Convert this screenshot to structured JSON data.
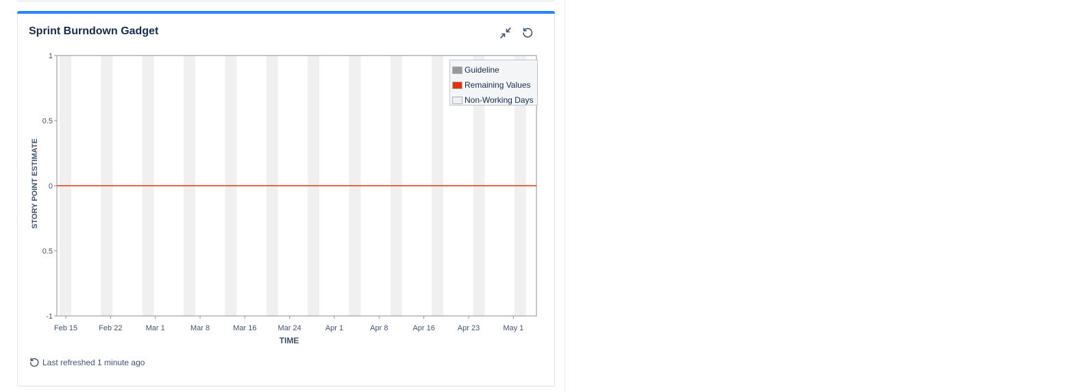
{
  "gadget": {
    "title": "Sprint Burndown Gadget",
    "accent_color": "#2684ff",
    "actions": [
      {
        "icon": "minimize-icon"
      },
      {
        "icon": "refresh-icon"
      }
    ],
    "footer": {
      "icon": "refresh-icon",
      "text": "Last refreshed 1 minute ago"
    }
  },
  "chart_data": {
    "type": "line",
    "xlabel": "TIME",
    "ylabel": "STORY POINT ESTIMATE",
    "x_tick_labels": [
      "Feb 15",
      "Feb 22",
      "Mar 1",
      "Mar 8",
      "Mar 16",
      "Mar 24",
      "Apr 1",
      "Apr 8",
      "Apr 16",
      "Apr 23",
      "May 1"
    ],
    "y_tick_labels": [
      "1",
      "0.5",
      "0",
      "0.5",
      "-1"
    ],
    "ylim": [
      -1,
      1
    ],
    "series": [
      {
        "name": "Remaining Values",
        "color": "#de350b",
        "values": [
          0,
          0,
          0,
          0,
          0,
          0,
          0,
          0,
          0,
          0,
          0
        ]
      }
    ],
    "legend": {
      "placement": "top-right",
      "items": [
        {
          "label": "Guideline",
          "color": "#999999"
        },
        {
          "label": "Remaining Values",
          "color": "#de350b"
        },
        {
          "label": "Non-Working Days",
          "color": "#f0f0f0"
        }
      ]
    },
    "non_working_day_bands": 12,
    "grid": false
  }
}
